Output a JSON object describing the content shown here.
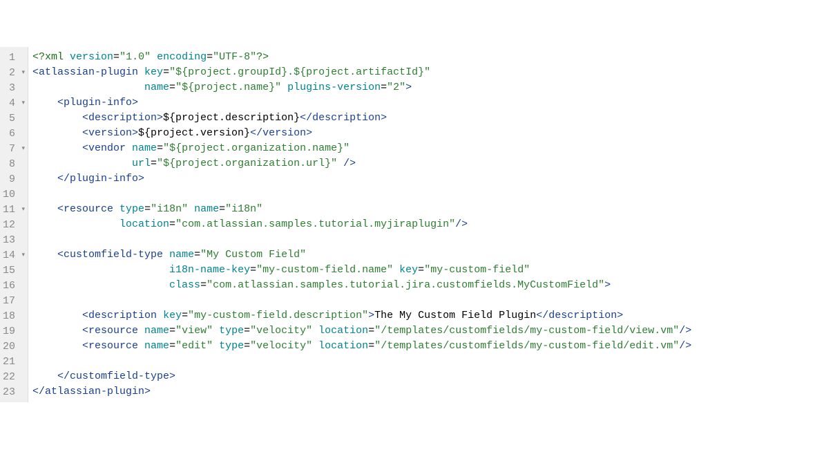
{
  "lines": [
    {
      "num": "1",
      "fold": "",
      "html": "<span class='pi'>&lt;?xml</span> <span class='att'>version</span>=<span class='val'>\"1.0\"</span> <span class='att'>encoding</span>=<span class='val'>\"UTF-8\"</span><span class='pi'>?&gt;</span>"
    },
    {
      "num": "2",
      "fold": "▾",
      "html": "<span class='tag'>&lt;atlassian-plugin</span> <span class='att'>key</span>=<span class='val'>\"${project.groupId}.${project.artifactId}\"</span>"
    },
    {
      "num": "3",
      "fold": "",
      "html": "                  <span class='att'>name</span>=<span class='val'>\"${project.name}\"</span> <span class='att'>plugins-version</span>=<span class='val'>\"2\"</span><span class='tag'>&gt;</span>"
    },
    {
      "num": "4",
      "fold": "▾",
      "html": "    <span class='tag'>&lt;plugin-info&gt;</span>"
    },
    {
      "num": "5",
      "fold": "",
      "html": "        <span class='tag'>&lt;description&gt;</span><span class='txt'>${project.description}</span><span class='tag'>&lt;/description&gt;</span>"
    },
    {
      "num": "6",
      "fold": "",
      "html": "        <span class='tag'>&lt;version&gt;</span><span class='txt'>${project.version}</span><span class='tag'>&lt;/version&gt;</span>"
    },
    {
      "num": "7",
      "fold": "▾",
      "html": "        <span class='tag'>&lt;vendor</span> <span class='att'>name</span>=<span class='val'>\"${project.organization.name}\"</span>"
    },
    {
      "num": "8",
      "fold": "",
      "html": "                <span class='att'>url</span>=<span class='val'>\"${project.organization.url}\"</span> <span class='tag'>/&gt;</span>"
    },
    {
      "num": "9",
      "fold": "",
      "html": "    <span class='tag'>&lt;/plugin-info&gt;</span>"
    },
    {
      "num": "10",
      "fold": "",
      "html": ""
    },
    {
      "num": "11",
      "fold": "▾",
      "html": "    <span class='tag'>&lt;resource</span> <span class='att'>type</span>=<span class='val'>\"i18n\"</span> <span class='att'>name</span>=<span class='val'>\"i18n\"</span>"
    },
    {
      "num": "12",
      "fold": "",
      "html": "              <span class='att'>location</span>=<span class='val'>\"com.atlassian.samples.tutorial.myjiraplugin\"</span><span class='tag'>/&gt;</span>"
    },
    {
      "num": "13",
      "fold": "",
      "html": ""
    },
    {
      "num": "14",
      "fold": "▾",
      "html": "    <span class='tag'>&lt;customfield-type</span> <span class='att'>name</span>=<span class='val'>\"My Custom Field\"</span>"
    },
    {
      "num": "15",
      "fold": "",
      "html": "                      <span class='att'>i18n-name-key</span>=<span class='val'>\"my-custom-field.name\"</span> <span class='att'>key</span>=<span class='val'>\"my-custom-field\"</span>"
    },
    {
      "num": "16",
      "fold": "",
      "html": "                      <span class='att'>class</span>=<span class='val'>\"com.atlassian.samples.tutorial.jira.customfields.MyCustomField\"</span><span class='tag'>&gt;</span>"
    },
    {
      "num": "17",
      "fold": "",
      "html": ""
    },
    {
      "num": "18",
      "fold": "",
      "html": "        <span class='tag'>&lt;description</span> <span class='att'>key</span>=<span class='val'>\"my-custom-field.description\"</span><span class='tag'>&gt;</span><span class='txt'>The My Custom Field Plugin</span><span class='tag'>&lt;/description&gt;</span>"
    },
    {
      "num": "19",
      "fold": "",
      "html": "        <span class='tag'>&lt;resource</span> <span class='att'>name</span>=<span class='val'>\"view\"</span> <span class='att'>type</span>=<span class='val'>\"velocity\"</span> <span class='att'>location</span>=<span class='val'>\"/templates/customfields/my-custom-field/view.vm\"</span><span class='tag'>/&gt;</span>"
    },
    {
      "num": "20",
      "fold": "",
      "html": "        <span class='tag'>&lt;resource</span> <span class='att'>name</span>=<span class='val'>\"edit\"</span> <span class='att'>type</span>=<span class='val'>\"velocity\"</span> <span class='att'>location</span>=<span class='val'>\"/templates/customfields/my-custom-field/edit.vm\"</span><span class='tag'>/&gt;</span>"
    },
    {
      "num": "21",
      "fold": "",
      "html": ""
    },
    {
      "num": "22",
      "fold": "",
      "html": "    <span class='tag'>&lt;/customfield-type&gt;</span>"
    },
    {
      "num": "23",
      "fold": "",
      "html": "<span class='tag'>&lt;/atlassian-plugin&gt;</span>"
    }
  ]
}
